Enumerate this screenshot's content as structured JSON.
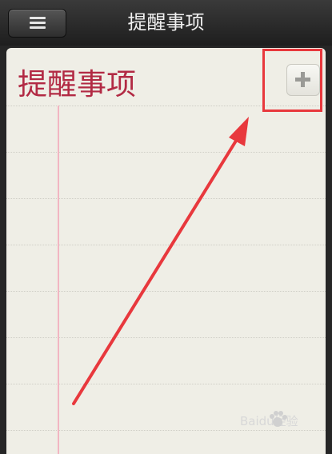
{
  "navbar": {
    "menu_icon": "menu-icon",
    "title": "提醒事项"
  },
  "list": {
    "title": "提醒事项",
    "add_icon": "plus-icon",
    "title_color": "#b22a44"
  },
  "annotation": {
    "highlight_color": "#e8383d"
  },
  "watermark": {
    "text": "Baidu经验",
    "icon": "paw-icon"
  }
}
